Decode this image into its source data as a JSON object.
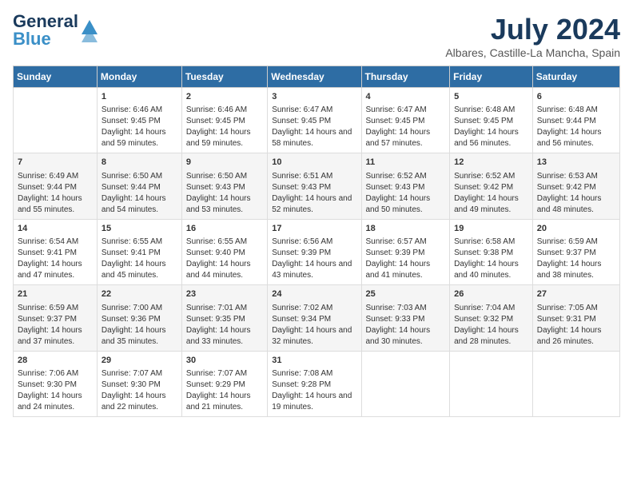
{
  "header": {
    "logo_line1": "General",
    "logo_line2": "Blue",
    "month_year": "July 2024",
    "location": "Albares, Castille-La Mancha, Spain"
  },
  "days_of_week": [
    "Sunday",
    "Monday",
    "Tuesday",
    "Wednesday",
    "Thursday",
    "Friday",
    "Saturday"
  ],
  "weeks": [
    [
      {
        "day": "",
        "sunrise": "",
        "sunset": "",
        "daylight": ""
      },
      {
        "day": "1",
        "sunrise": "Sunrise: 6:46 AM",
        "sunset": "Sunset: 9:45 PM",
        "daylight": "Daylight: 14 hours and 59 minutes."
      },
      {
        "day": "2",
        "sunrise": "Sunrise: 6:46 AM",
        "sunset": "Sunset: 9:45 PM",
        "daylight": "Daylight: 14 hours and 59 minutes."
      },
      {
        "day": "3",
        "sunrise": "Sunrise: 6:47 AM",
        "sunset": "Sunset: 9:45 PM",
        "daylight": "Daylight: 14 hours and 58 minutes."
      },
      {
        "day": "4",
        "sunrise": "Sunrise: 6:47 AM",
        "sunset": "Sunset: 9:45 PM",
        "daylight": "Daylight: 14 hours and 57 minutes."
      },
      {
        "day": "5",
        "sunrise": "Sunrise: 6:48 AM",
        "sunset": "Sunset: 9:45 PM",
        "daylight": "Daylight: 14 hours and 56 minutes."
      },
      {
        "day": "6",
        "sunrise": "Sunrise: 6:48 AM",
        "sunset": "Sunset: 9:44 PM",
        "daylight": "Daylight: 14 hours and 56 minutes."
      }
    ],
    [
      {
        "day": "7",
        "sunrise": "Sunrise: 6:49 AM",
        "sunset": "Sunset: 9:44 PM",
        "daylight": "Daylight: 14 hours and 55 minutes."
      },
      {
        "day": "8",
        "sunrise": "Sunrise: 6:50 AM",
        "sunset": "Sunset: 9:44 PM",
        "daylight": "Daylight: 14 hours and 54 minutes."
      },
      {
        "day": "9",
        "sunrise": "Sunrise: 6:50 AM",
        "sunset": "Sunset: 9:43 PM",
        "daylight": "Daylight: 14 hours and 53 minutes."
      },
      {
        "day": "10",
        "sunrise": "Sunrise: 6:51 AM",
        "sunset": "Sunset: 9:43 PM",
        "daylight": "Daylight: 14 hours and 52 minutes."
      },
      {
        "day": "11",
        "sunrise": "Sunrise: 6:52 AM",
        "sunset": "Sunset: 9:43 PM",
        "daylight": "Daylight: 14 hours and 50 minutes."
      },
      {
        "day": "12",
        "sunrise": "Sunrise: 6:52 AM",
        "sunset": "Sunset: 9:42 PM",
        "daylight": "Daylight: 14 hours and 49 minutes."
      },
      {
        "day": "13",
        "sunrise": "Sunrise: 6:53 AM",
        "sunset": "Sunset: 9:42 PM",
        "daylight": "Daylight: 14 hours and 48 minutes."
      }
    ],
    [
      {
        "day": "14",
        "sunrise": "Sunrise: 6:54 AM",
        "sunset": "Sunset: 9:41 PM",
        "daylight": "Daylight: 14 hours and 47 minutes."
      },
      {
        "day": "15",
        "sunrise": "Sunrise: 6:55 AM",
        "sunset": "Sunset: 9:41 PM",
        "daylight": "Daylight: 14 hours and 45 minutes."
      },
      {
        "day": "16",
        "sunrise": "Sunrise: 6:55 AM",
        "sunset": "Sunset: 9:40 PM",
        "daylight": "Daylight: 14 hours and 44 minutes."
      },
      {
        "day": "17",
        "sunrise": "Sunrise: 6:56 AM",
        "sunset": "Sunset: 9:39 PM",
        "daylight": "Daylight: 14 hours and 43 minutes."
      },
      {
        "day": "18",
        "sunrise": "Sunrise: 6:57 AM",
        "sunset": "Sunset: 9:39 PM",
        "daylight": "Daylight: 14 hours and 41 minutes."
      },
      {
        "day": "19",
        "sunrise": "Sunrise: 6:58 AM",
        "sunset": "Sunset: 9:38 PM",
        "daylight": "Daylight: 14 hours and 40 minutes."
      },
      {
        "day": "20",
        "sunrise": "Sunrise: 6:59 AM",
        "sunset": "Sunset: 9:37 PM",
        "daylight": "Daylight: 14 hours and 38 minutes."
      }
    ],
    [
      {
        "day": "21",
        "sunrise": "Sunrise: 6:59 AM",
        "sunset": "Sunset: 9:37 PM",
        "daylight": "Daylight: 14 hours and 37 minutes."
      },
      {
        "day": "22",
        "sunrise": "Sunrise: 7:00 AM",
        "sunset": "Sunset: 9:36 PM",
        "daylight": "Daylight: 14 hours and 35 minutes."
      },
      {
        "day": "23",
        "sunrise": "Sunrise: 7:01 AM",
        "sunset": "Sunset: 9:35 PM",
        "daylight": "Daylight: 14 hours and 33 minutes."
      },
      {
        "day": "24",
        "sunrise": "Sunrise: 7:02 AM",
        "sunset": "Sunset: 9:34 PM",
        "daylight": "Daylight: 14 hours and 32 minutes."
      },
      {
        "day": "25",
        "sunrise": "Sunrise: 7:03 AM",
        "sunset": "Sunset: 9:33 PM",
        "daylight": "Daylight: 14 hours and 30 minutes."
      },
      {
        "day": "26",
        "sunrise": "Sunrise: 7:04 AM",
        "sunset": "Sunset: 9:32 PM",
        "daylight": "Daylight: 14 hours and 28 minutes."
      },
      {
        "day": "27",
        "sunrise": "Sunrise: 7:05 AM",
        "sunset": "Sunset: 9:31 PM",
        "daylight": "Daylight: 14 hours and 26 minutes."
      }
    ],
    [
      {
        "day": "28",
        "sunrise": "Sunrise: 7:06 AM",
        "sunset": "Sunset: 9:30 PM",
        "daylight": "Daylight: 14 hours and 24 minutes."
      },
      {
        "day": "29",
        "sunrise": "Sunrise: 7:07 AM",
        "sunset": "Sunset: 9:30 PM",
        "daylight": "Daylight: 14 hours and 22 minutes."
      },
      {
        "day": "30",
        "sunrise": "Sunrise: 7:07 AM",
        "sunset": "Sunset: 9:29 PM",
        "daylight": "Daylight: 14 hours and 21 minutes."
      },
      {
        "day": "31",
        "sunrise": "Sunrise: 7:08 AM",
        "sunset": "Sunset: 9:28 PM",
        "daylight": "Daylight: 14 hours and 19 minutes."
      },
      {
        "day": "",
        "sunrise": "",
        "sunset": "",
        "daylight": ""
      },
      {
        "day": "",
        "sunrise": "",
        "sunset": "",
        "daylight": ""
      },
      {
        "day": "",
        "sunrise": "",
        "sunset": "",
        "daylight": ""
      }
    ]
  ]
}
